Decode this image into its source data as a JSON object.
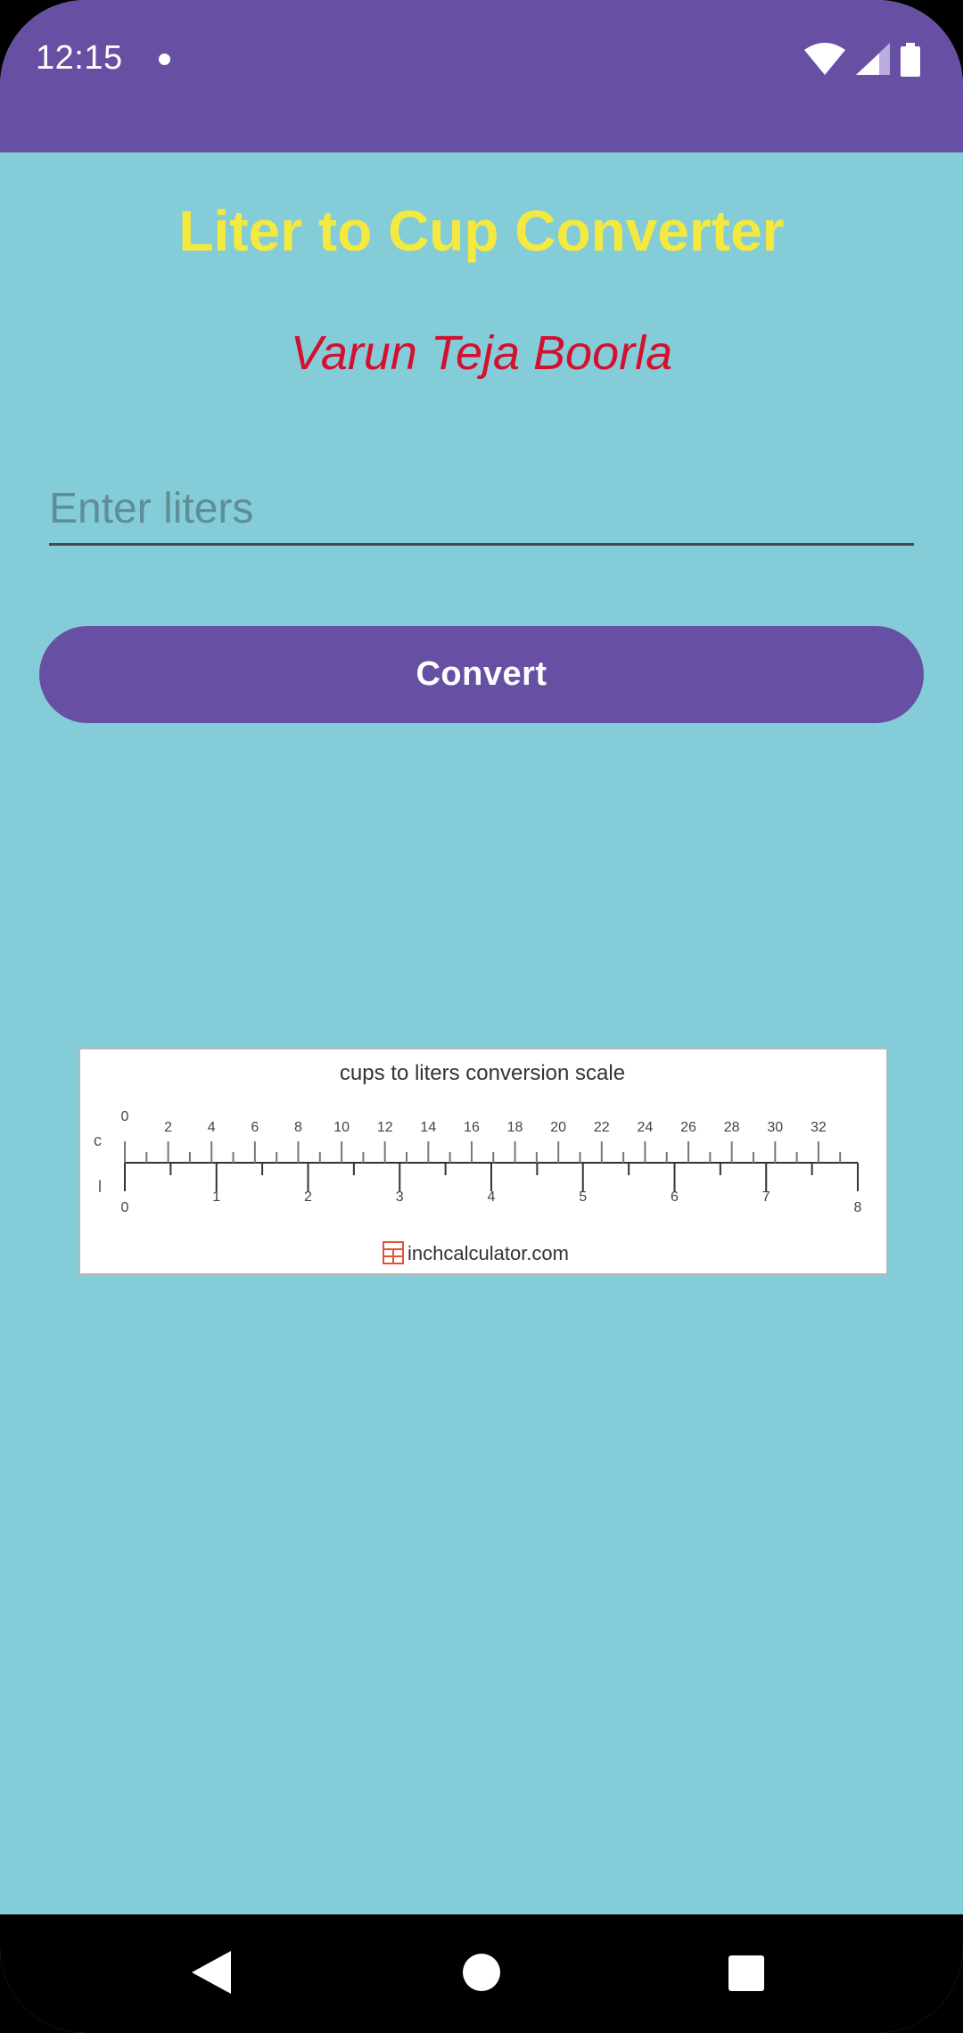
{
  "status_bar": {
    "time": "12:15",
    "notification_dot": "notification-dot",
    "icons": [
      "wifi-icon",
      "signal-icon",
      "battery-icon"
    ]
  },
  "app": {
    "title": "Liter to Cup Converter",
    "author": "Varun Teja Boorla"
  },
  "input": {
    "placeholder": "Enter liters",
    "value": ""
  },
  "convert_button": {
    "label": "Convert"
  },
  "scale_image": {
    "title": "cups to liters conversion scale",
    "cups_axis_label": "c",
    "liters_axis_label": "l",
    "cups_labels": [
      "0",
      "2",
      "4",
      "6",
      "8",
      "10",
      "12",
      "14",
      "16",
      "18",
      "20",
      "22",
      "24",
      "26",
      "28",
      "30",
      "32"
    ],
    "liters_labels": [
      "0",
      "1",
      "2",
      "3",
      "4",
      "5",
      "6",
      "7",
      "8"
    ],
    "source": "inchcalculator.com",
    "source_icon": "calculator-icon"
  },
  "nav_bar": {
    "icons": [
      "back-icon",
      "home-icon",
      "recents-icon"
    ]
  },
  "colors": {
    "primary": "#6750a4",
    "background": "#84cdd8",
    "title": "#f4e93f",
    "author": "#d4102f"
  }
}
